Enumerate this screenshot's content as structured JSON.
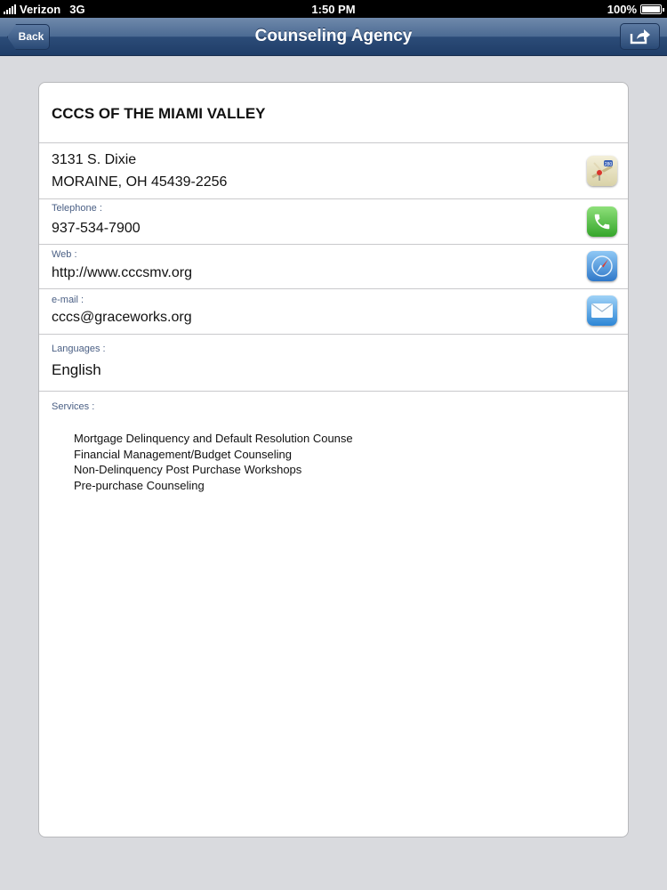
{
  "status_bar": {
    "carrier": "Verizon",
    "network": "3G",
    "time": "1:50 PM",
    "battery": "100%"
  },
  "nav_bar": {
    "title": "Counseling Agency",
    "back_label": "Back",
    "share_icon": "share-icon"
  },
  "agency": {
    "name": "CCCS OF THE MIAMI VALLEY",
    "address_line1": "3131 S. Dixie",
    "address_line2": "MORAINE, OH 45439-2256",
    "telephone_label": "Telephone :",
    "telephone": "937-534-7900",
    "web_label": "Web :",
    "web": "http://www.cccsmv.org",
    "email_label": "e-mail :",
    "email": "cccs@graceworks.org",
    "languages_label": "Languages :",
    "languages": "English",
    "services_label": "Services :",
    "services": [
      "Mortgage Delinquency and Default Resolution Counse",
      "Financial Management/Budget Counseling",
      "Non-Delinquency Post Purchase Workshops",
      "Pre-purchase Counseling"
    ]
  },
  "icons": {
    "address": "maps-icon",
    "telephone": "phone-icon",
    "web": "safari-icon",
    "email": "mail-icon"
  }
}
